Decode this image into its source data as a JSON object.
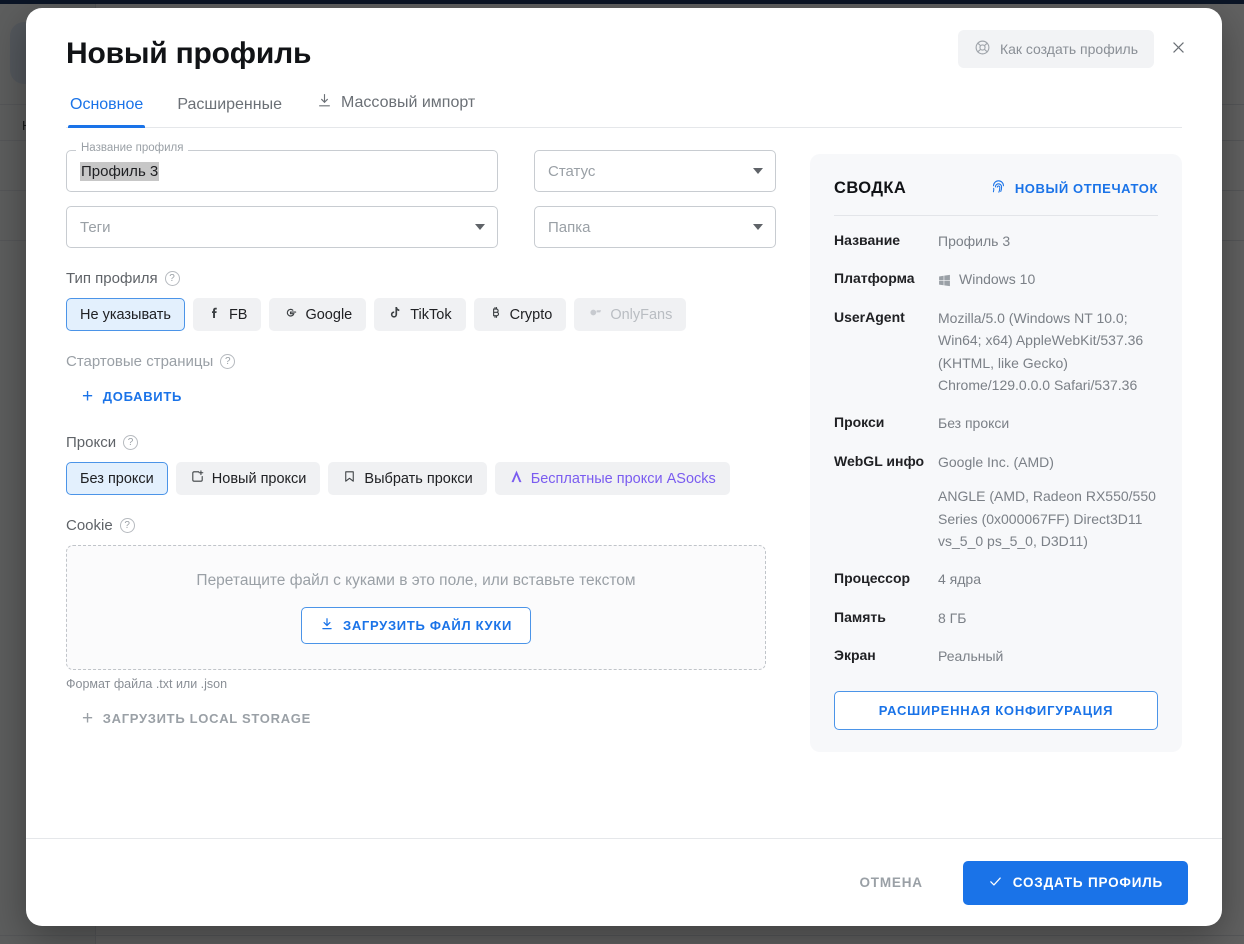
{
  "background": {
    "app_label": "На",
    "logo_icon": "shield-key-icon"
  },
  "modal": {
    "title": "Новый профиль",
    "help_button": {
      "label": "Как создать профиль",
      "icon": "lifebuoy-icon"
    },
    "close_icon": "close-icon",
    "tabs": [
      {
        "label": "Основное",
        "icon": null,
        "active": true
      },
      {
        "label": "Расширенные",
        "icon": null,
        "active": false
      },
      {
        "label": "Массовый импорт",
        "icon": "download-icon",
        "active": false
      }
    ],
    "form": {
      "profile_name": {
        "legend": "Название профиля",
        "value": "Профиль 3"
      },
      "status": {
        "placeholder": "Статус"
      },
      "tags": {
        "placeholder": "Теги"
      },
      "folder": {
        "placeholder": "Папка"
      },
      "profile_type": {
        "label": "Тип профиля",
        "options": [
          {
            "label": "Не указывать",
            "icon": null,
            "selected": true,
            "disabled": false
          },
          {
            "label": "FB",
            "icon": "facebook-icon",
            "selected": false,
            "disabled": false
          },
          {
            "label": "Google",
            "icon": "google-icon",
            "selected": false,
            "disabled": false
          },
          {
            "label": "TikTok",
            "icon": "tiktok-icon",
            "selected": false,
            "disabled": false
          },
          {
            "label": "Crypto",
            "icon": "bitcoin-icon",
            "selected": false,
            "disabled": false
          },
          {
            "label": "OnlyFans",
            "icon": "onlyfans-icon",
            "selected": false,
            "disabled": true
          }
        ]
      },
      "start_pages": {
        "label": "Стартовые страницы",
        "add_label": "ДОБАВИТЬ"
      },
      "proxy": {
        "label": "Прокси",
        "options": [
          {
            "label": "Без прокси",
            "icon": null,
            "selected": true,
            "link": false
          },
          {
            "label": "Новый прокси",
            "icon": "new-proxy-icon",
            "selected": false,
            "link": false
          },
          {
            "label": "Выбрать прокси",
            "icon": "bookmark-icon",
            "selected": false,
            "link": false
          },
          {
            "label": "Бесплатные прокси ASocks",
            "icon": "asocks-icon",
            "selected": false,
            "link": true
          }
        ]
      },
      "cookie": {
        "label": "Cookie",
        "dropzone_text": "Перетащите файл с куками в это поле, или вставьте текстом",
        "upload_label": "ЗАГРУЗИТЬ ФАЙЛ КУКИ",
        "file_hint": "Формат файла .txt или .json",
        "local_storage_label": "ЗАГРУЗИТЬ LOCAL STORAGE"
      }
    },
    "summary": {
      "title": "СВОДКА",
      "fingerprint_button": {
        "label": "НОВЫЙ ОТПЕЧАТОК",
        "icon": "fingerprint-icon"
      },
      "rows": [
        {
          "key": "Название",
          "lines": [
            "Профиль 3"
          ],
          "icon": null
        },
        {
          "key": "Платформа",
          "lines": [
            "Windows 10"
          ],
          "icon": "windows-icon"
        },
        {
          "key": "UserAgent",
          "lines": [
            "Mozilla/5.0 (Windows NT 10.0;",
            "Win64; x64) AppleWebKit/537.36",
            "(KHTML, like Gecko)",
            "Chrome/129.0.0.0 Safari/537.36"
          ],
          "icon": null
        },
        {
          "key": "Прокси",
          "lines": [
            "Без прокси"
          ],
          "icon": null
        },
        {
          "key": "WebGL инфо",
          "lines": [
            "Google Inc. (AMD)",
            "",
            "ANGLE (AMD, Radeon RX550/550",
            "Series (0x000067FF) Direct3D11",
            "vs_5_0 ps_5_0, D3D11)"
          ],
          "icon": null
        },
        {
          "key": "Процессор",
          "lines": [
            "4 ядра"
          ],
          "icon": null
        },
        {
          "key": "Память",
          "lines": [
            "8 ГБ"
          ],
          "icon": null
        },
        {
          "key": "Экран",
          "lines": [
            "Реальный"
          ],
          "icon": null
        }
      ],
      "advanced_button": "РАСШИРЕННАЯ КОНФИГУРАЦИЯ"
    },
    "footer": {
      "cancel_label": "ОТМЕНА",
      "create_label": "СОЗДАТЬ ПРОФИЛЬ",
      "create_icon": "check-icon"
    }
  },
  "colors": {
    "accent": "#1a73e8",
    "accent_soft": "#e3f0fd",
    "link_purple": "#7a5cf0",
    "text_primary": "#202124",
    "text_muted": "#9aa0a6",
    "panel_bg": "#f7f8fa"
  }
}
